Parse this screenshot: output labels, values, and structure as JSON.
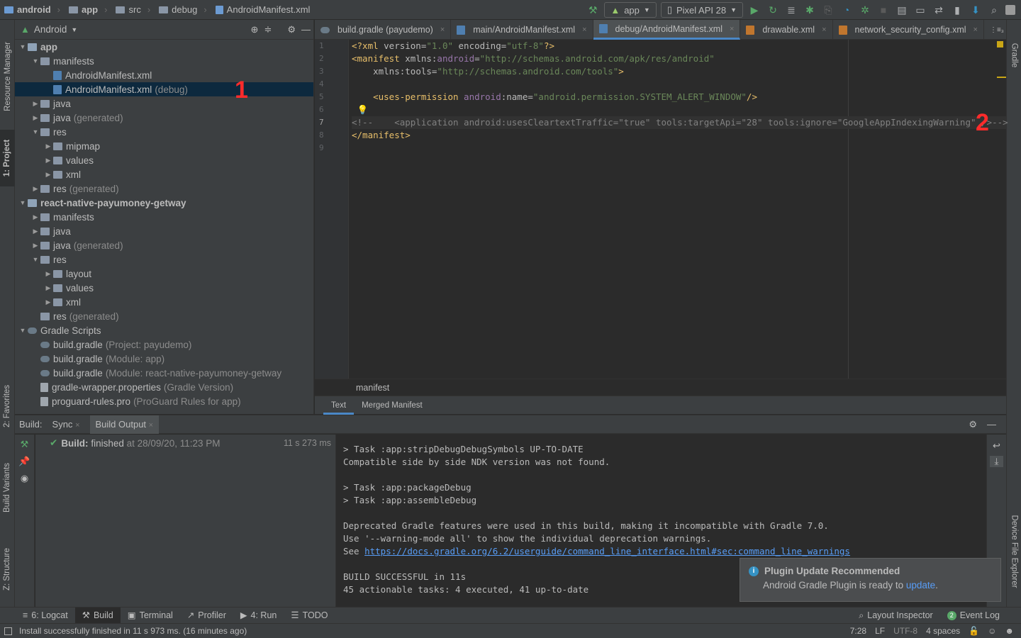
{
  "navbar": {
    "crumbs": [
      "android",
      "app",
      "src",
      "debug",
      "AndroidManifest.xml"
    ],
    "run_config": "app",
    "device": "Pixel API 28"
  },
  "left_strip": {
    "resource_manager": "Resource Manager",
    "project": "1: Project",
    "favorites": "2: Favorites",
    "build_variants": "Build Variants",
    "structure": "Z: Structure"
  },
  "right_strip": {
    "gradle": "Gradle",
    "device_file_explorer": "Device File Explorer"
  },
  "project": {
    "view_mode": "Android",
    "tree": [
      {
        "label": "app",
        "extra": "",
        "depth": 0,
        "arrow": "down",
        "icon": "module",
        "bold": true
      },
      {
        "label": "manifests",
        "extra": "",
        "depth": 1,
        "arrow": "down",
        "icon": "folder"
      },
      {
        "label": "AndroidManifest.xml",
        "extra": "",
        "depth": 2,
        "arrow": "",
        "icon": "xml"
      },
      {
        "label": "AndroidManifest.xml",
        "extra": "(debug)",
        "depth": 2,
        "arrow": "",
        "icon": "xml",
        "selected": true
      },
      {
        "label": "java",
        "extra": "",
        "depth": 1,
        "arrow": "right",
        "icon": "folder"
      },
      {
        "label": "java",
        "extra": "(generated)",
        "depth": 1,
        "arrow": "right",
        "icon": "folder"
      },
      {
        "label": "res",
        "extra": "",
        "depth": 1,
        "arrow": "down",
        "icon": "folder"
      },
      {
        "label": "mipmap",
        "extra": "",
        "depth": 2,
        "arrow": "right",
        "icon": "folder"
      },
      {
        "label": "values",
        "extra": "",
        "depth": 2,
        "arrow": "right",
        "icon": "folder"
      },
      {
        "label": "xml",
        "extra": "",
        "depth": 2,
        "arrow": "right",
        "icon": "folder"
      },
      {
        "label": "res",
        "extra": "(generated)",
        "depth": 1,
        "arrow": "right",
        "icon": "folder"
      },
      {
        "label": "react-native-payumoney-getway",
        "extra": "",
        "depth": 0,
        "arrow": "down",
        "icon": "module",
        "bold": true
      },
      {
        "label": "manifests",
        "extra": "",
        "depth": 1,
        "arrow": "right",
        "icon": "folder"
      },
      {
        "label": "java",
        "extra": "",
        "depth": 1,
        "arrow": "right",
        "icon": "folder"
      },
      {
        "label": "java",
        "extra": "(generated)",
        "depth": 1,
        "arrow": "right",
        "icon": "folder"
      },
      {
        "label": "res",
        "extra": "",
        "depth": 1,
        "arrow": "down",
        "icon": "folder"
      },
      {
        "label": "layout",
        "extra": "",
        "depth": 2,
        "arrow": "right",
        "icon": "folder"
      },
      {
        "label": "values",
        "extra": "",
        "depth": 2,
        "arrow": "right",
        "icon": "folder"
      },
      {
        "label": "xml",
        "extra": "",
        "depth": 2,
        "arrow": "right",
        "icon": "folder"
      },
      {
        "label": "res",
        "extra": "(generated)",
        "depth": 1,
        "arrow": "",
        "icon": "folder"
      },
      {
        "label": "Gradle Scripts",
        "extra": "",
        "depth": 0,
        "arrow": "down",
        "icon": "gradle"
      },
      {
        "label": "build.gradle",
        "extra": "(Project: payudemo)",
        "depth": 1,
        "arrow": "",
        "icon": "gradle"
      },
      {
        "label": "build.gradle",
        "extra": "(Module: app)",
        "depth": 1,
        "arrow": "",
        "icon": "gradle"
      },
      {
        "label": "build.gradle",
        "extra": "(Module: react-native-payumoney-getway",
        "depth": 1,
        "arrow": "",
        "icon": "gradle"
      },
      {
        "label": "gradle-wrapper.properties",
        "extra": "(Gradle Version)",
        "depth": 1,
        "arrow": "",
        "icon": "file"
      },
      {
        "label": "proguard-rules.pro",
        "extra": "(ProGuard Rules for app)",
        "depth": 1,
        "arrow": "",
        "icon": "file"
      }
    ]
  },
  "annotations": {
    "one": "1",
    "two": "2"
  },
  "editor": {
    "tabs": [
      {
        "label": "build.gradle (payudemo)",
        "active": false
      },
      {
        "label": "main/AndroidManifest.xml",
        "active": false
      },
      {
        "label": "debug/AndroidManifest.xml",
        "active": true
      },
      {
        "label": "drawable.xml",
        "active": false
      },
      {
        "label": "network_security_config.xml",
        "active": false
      }
    ],
    "tab_overflow": "⋮≡₃",
    "line_numbers": [
      "1",
      "2",
      "3",
      "4",
      "5",
      "6",
      "7",
      "8",
      "9"
    ],
    "current_line": 7,
    "breadcrumb": "manifest",
    "bottom_tabs": [
      "Text",
      "Merged Manifest"
    ]
  },
  "build": {
    "label": "Build:",
    "tabs": [
      "Sync",
      "Build Output"
    ],
    "result_label": "Build:",
    "result_text": "finished",
    "result_time": "at 28/09/20, 11:23 PM",
    "duration": "11 s 273 ms",
    "console": [
      "> Task :app:stripDebugDebugSymbols UP-TO-DATE",
      "Compatible side by side NDK version was not found.",
      "",
      "> Task :app:packageDebug",
      "> Task :app:assembleDebug",
      "",
      "Deprecated Gradle features were used in this build, making it incompatible with Gradle 7.0.",
      "Use '--warning-mode all' to show the individual deprecation warnings.",
      "",
      "",
      "BUILD SUCCESSFUL in 11s",
      "45 actionable tasks: 4 executed, 41 up-to-date"
    ],
    "see_prefix": "See ",
    "see_link": "https://docs.gradle.org/6.2/userguide/command_line_interface.html#sec:command_line_warnings"
  },
  "notification": {
    "title": "Plugin Update Recommended",
    "body_prefix": "Android Gradle Plugin is ready to ",
    "body_link": "update",
    "body_suffix": "."
  },
  "bottom_tools": {
    "logcat": "6: Logcat",
    "build": "Build",
    "terminal": "Terminal",
    "profiler": "Profiler",
    "run": "4: Run",
    "todo": "TODO",
    "layout_inspector": "Layout Inspector",
    "event_log": "Event Log",
    "event_log_count": "2"
  },
  "status": {
    "message": "Install successfully finished in 11 s 973 ms. (16 minutes ago)",
    "position": "7:28",
    "line_sep": "LF",
    "encoding": "UTF-8",
    "indent": "4 spaces"
  },
  "colors": {
    "accent": "#4a88c7",
    "selection": "#0d293e",
    "annotation_red": "#ff2b2b",
    "success_green": "#59a869",
    "link": "#589df6"
  }
}
